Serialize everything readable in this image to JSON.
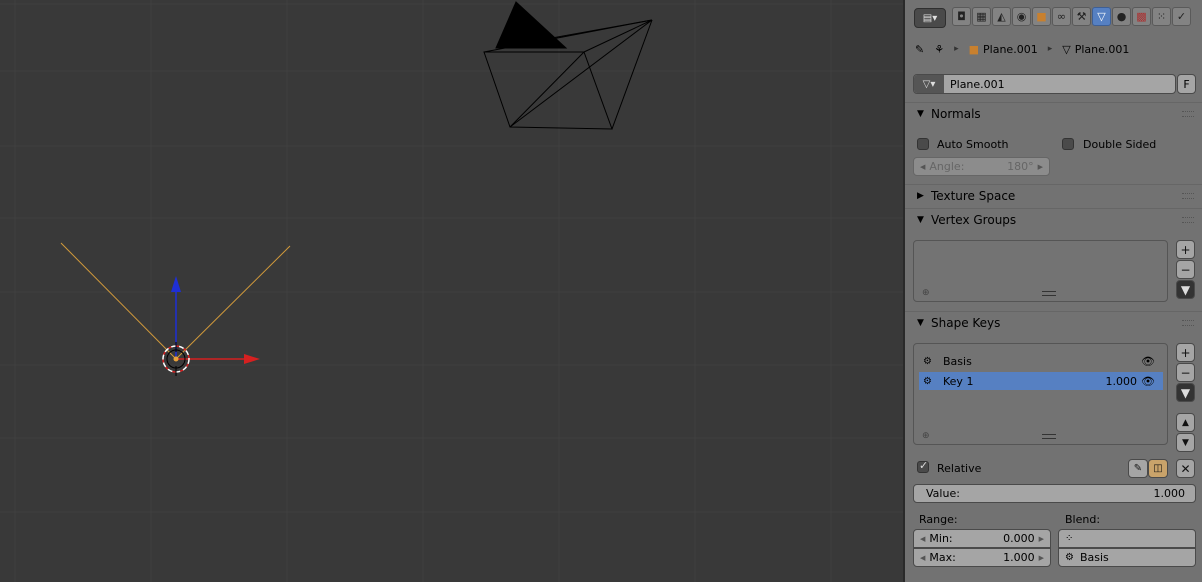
{
  "breadcrumb": {
    "object_name": "Plane.001",
    "mesh_name": "Plane.001"
  },
  "datablock": {
    "name": "Plane.001",
    "fake_user_label": "F"
  },
  "normals": {
    "title": "Normals",
    "auto_smooth_label": "Auto Smooth",
    "double_sided_label": "Double Sided",
    "angle_label": "Angle:",
    "angle_value": "180°"
  },
  "texture_space": {
    "title": "Texture Space"
  },
  "vertex_groups": {
    "title": "Vertex Groups"
  },
  "shape_keys": {
    "title": "Shape Keys",
    "items": [
      {
        "name": "Basis",
        "value": ""
      },
      {
        "name": "Key 1",
        "value": "1.000"
      }
    ],
    "relative_label": "Relative",
    "value_label": "Value:",
    "value": "1.000",
    "range_label": "Range:",
    "blend_label": "Blend:",
    "min_label": "Min:",
    "min_value": "0.000",
    "max_label": "Max:",
    "max_value": "1.000",
    "blend_vgroup_value": "",
    "relative_key_value": "Basis"
  },
  "colors": {
    "viewport_bg": "#393939",
    "panel_bg": "#727272",
    "selection": "#5680c2",
    "axis_x": "#d62020",
    "axis_z": "#1e2fd6",
    "camera_lines": "#d29a3b"
  },
  "icons": {
    "editor_type": "properties-editor-icon",
    "pin": "pin-icon",
    "add": "plus-icon",
    "remove": "minus-icon",
    "specials": "down-arrow-icon",
    "move_up": "up-arrow-icon",
    "move_down": "down-arrow-icon",
    "clear": "x-icon",
    "eye": "eye-icon"
  }
}
